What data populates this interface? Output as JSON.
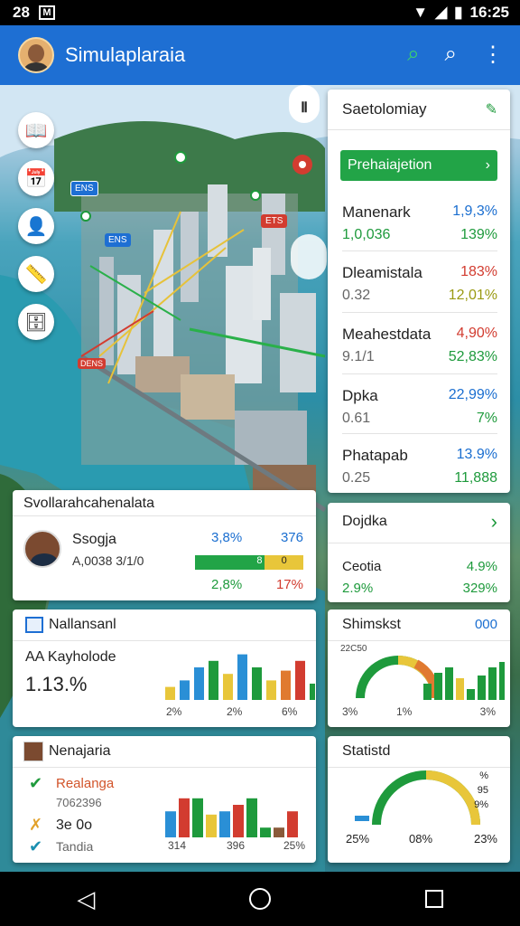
{
  "status": {
    "left1": "28",
    "left2": "M",
    "time": "16:25"
  },
  "appbar": {
    "title": "Simulaplaraia"
  },
  "map_labels": [
    "ENS",
    "ENS",
    "ETS",
    "DENS"
  ],
  "panel": {
    "title": "Saetolomiay",
    "button_label": "Prehaiajetion",
    "rows": [
      {
        "name": "Manenark",
        "value": "1,0,036",
        "p1": "1,9,3%",
        "p2": "139%"
      },
      {
        "name": "Dleamistala",
        "value": "0.32",
        "p1": "183%",
        "p2": "12,01%"
      },
      {
        "name": "Meahestdata",
        "value": "9.1/1",
        "p1": "4,90%",
        "p2": "52,83%"
      },
      {
        "name": "Dpka",
        "value": "0.61",
        "p1": "22,99%",
        "p2": "7%"
      },
      {
        "name": "Phatapab",
        "value": "0.25",
        "p1": "13.9%",
        "p2": "11,888"
      }
    ]
  },
  "card_profile": {
    "title": "Svollarahcahenalata",
    "name": "Ssogja",
    "sub": "A,0038 3/1/0",
    "val1": "3,8%",
    "val2": "376",
    "bar1": "8",
    "bar2": "0",
    "val3": "2,8%",
    "val4": "17%"
  },
  "card_small": {
    "title": "Dojdka",
    "label": "Ceotia",
    "p1": "4.9%",
    "p2": "2.9%",
    "p3": "329%"
  },
  "card_nal": {
    "title": "Nallansanl",
    "sub": "AA Kayholode",
    "value": "1.13.%",
    "ticks": [
      "2%",
      "2%",
      "6%"
    ],
    "bars": [
      4,
      6,
      10,
      12,
      8,
      14,
      10,
      6,
      9,
      12,
      5
    ],
    "colors": [
      "#e8c63a",
      "#2a8fd6",
      "#2a8fd6",
      "#1e9a3c",
      "#e8c63a",
      "#2a8fd6",
      "#1e9a3c",
      "#e8c63a",
      "#e07a30",
      "#d23c30",
      "#1e9a3c"
    ]
  },
  "card_shim": {
    "title": "Shimskst",
    "badge": "000",
    "gauge_text": "22C50",
    "ticks": [
      "3%",
      "1%",
      "3%"
    ],
    "bars": [
      6,
      10,
      12,
      8,
      4,
      9,
      12,
      14
    ],
    "colors": [
      "#1e9a3c",
      "#1e9a3c",
      "#1e9a3c",
      "#e8c63a",
      "#1e9a3c",
      "#1e9a3c",
      "#1e9a3c",
      "#1e9a3c"
    ]
  },
  "card_nena": {
    "title": "Nenajaria",
    "items": [
      {
        "icon": "check-icon",
        "label": "Realanga",
        "cls": "red"
      },
      {
        "icon": "blank",
        "label": "7062396",
        "cls": "grey"
      },
      {
        "icon": "cross-icon",
        "label": "3e 0o",
        "cls": "dark"
      },
      {
        "icon": "check-icon",
        "label": "Tandia",
        "cls": "grey"
      }
    ],
    "ticks": [
      "314",
      "396",
      "25%"
    ],
    "bars": [
      8,
      12,
      12,
      7,
      8,
      10,
      12,
      3,
      3,
      8
    ],
    "colors": [
      "#2a8fd6",
      "#d23c30",
      "#1e9a3c",
      "#e8c63a",
      "#2a8fd6",
      "#d23c30",
      "#1e9a3c",
      "#1e9a3c",
      "#8a5a3a",
      "#d23c30"
    ]
  },
  "card_stat": {
    "title": "Statistd",
    "ticks": [
      "25%",
      "08%",
      "23%"
    ],
    "right_labels": [
      "%",
      "95",
      "9%"
    ]
  }
}
